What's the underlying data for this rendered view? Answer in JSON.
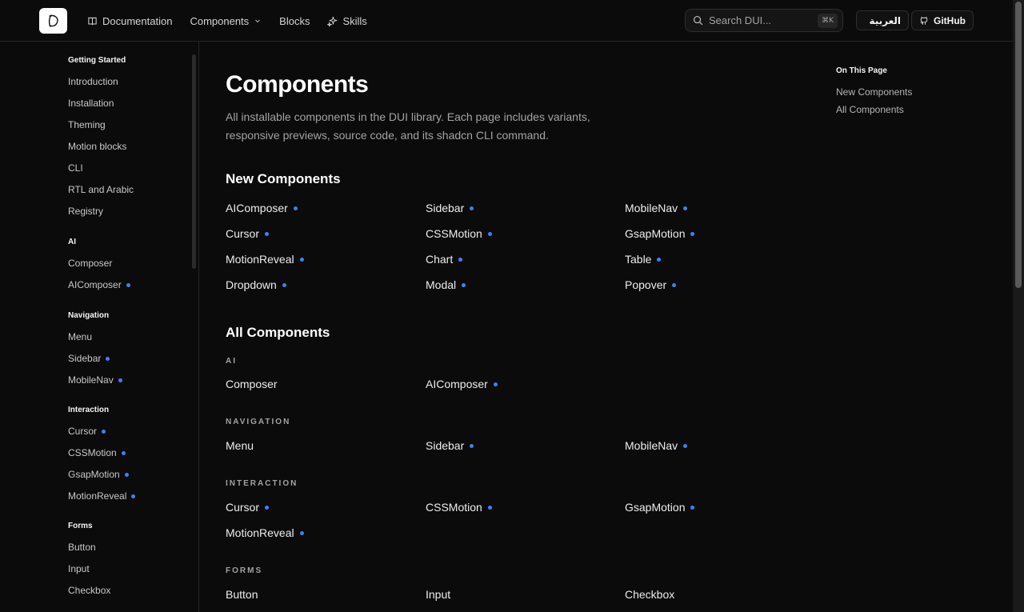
{
  "header": {
    "nav": [
      {
        "label": "Documentation",
        "icon": "book-icon"
      },
      {
        "label": "Components",
        "icon": "chevron-down-icon"
      },
      {
        "label": "Blocks"
      },
      {
        "label": "Skills",
        "icon": "sparkles-icon"
      }
    ],
    "search_placeholder": "Search DUI...",
    "search_shortcut": "⌘K",
    "language_label": "العربية",
    "github_label": "GitHub"
  },
  "sidebar": [
    {
      "title": "Getting Started",
      "items": [
        {
          "label": "Introduction",
          "new": false
        },
        {
          "label": "Installation",
          "new": false
        },
        {
          "label": "Theming",
          "new": false
        },
        {
          "label": "Motion blocks",
          "new": false
        },
        {
          "label": "CLI",
          "new": false
        },
        {
          "label": "RTL and Arabic",
          "new": false
        },
        {
          "label": "Registry",
          "new": false
        }
      ]
    },
    {
      "title": "AI",
      "items": [
        {
          "label": "Composer",
          "new": false
        },
        {
          "label": "AIComposer",
          "new": true
        }
      ]
    },
    {
      "title": "Navigation",
      "items": [
        {
          "label": "Menu",
          "new": false
        },
        {
          "label": "Sidebar",
          "new": true
        },
        {
          "label": "MobileNav",
          "new": true
        }
      ]
    },
    {
      "title": "Interaction",
      "items": [
        {
          "label": "Cursor",
          "new": true
        },
        {
          "label": "CSSMotion",
          "new": true
        },
        {
          "label": "GsapMotion",
          "new": true
        },
        {
          "label": "MotionReveal",
          "new": true
        }
      ]
    },
    {
      "title": "Forms",
      "items": [
        {
          "label": "Button",
          "new": false
        },
        {
          "label": "Input",
          "new": false
        },
        {
          "label": "Checkbox",
          "new": false
        }
      ]
    }
  ],
  "main": {
    "title": "Components",
    "description": "All installable components in the DUI library. Each page includes variants, responsive previews, source code, and its shadcn CLI command.",
    "new_heading": "New Components",
    "new_components": [
      [
        "AIComposer",
        "Sidebar",
        "MobileNav"
      ],
      [
        "Cursor",
        "CSSMotion",
        "GsapMotion"
      ],
      [
        "MotionReveal",
        "Chart",
        "Table"
      ],
      [
        "Dropdown",
        "Modal",
        "Popover"
      ]
    ],
    "all_heading": "All Components",
    "categories": [
      {
        "label": "AI",
        "rows": [
          [
            {
              "label": "Composer",
              "new": false
            },
            {
              "label": "AIComposer",
              "new": true
            }
          ]
        ]
      },
      {
        "label": "NAVIGATION",
        "rows": [
          [
            {
              "label": "Menu",
              "new": false
            },
            {
              "label": "Sidebar",
              "new": true
            },
            {
              "label": "MobileNav",
              "new": true
            }
          ]
        ]
      },
      {
        "label": "INTERACTION",
        "rows": [
          [
            {
              "label": "Cursor",
              "new": true
            },
            {
              "label": "CSSMotion",
              "new": true
            },
            {
              "label": "GsapMotion",
              "new": true
            }
          ],
          [
            {
              "label": "MotionReveal",
              "new": true
            }
          ]
        ]
      },
      {
        "label": "FORMS",
        "rows": [
          [
            {
              "label": "Button",
              "new": false
            },
            {
              "label": "Input",
              "new": false
            },
            {
              "label": "Checkbox",
              "new": false
            }
          ]
        ]
      }
    ]
  },
  "toc": {
    "title": "On This Page",
    "items": [
      "New Components",
      "All Components"
    ]
  },
  "colors": {
    "background": "#0b0b0b",
    "new_dot": "#3b82f6",
    "border": "#262626"
  }
}
